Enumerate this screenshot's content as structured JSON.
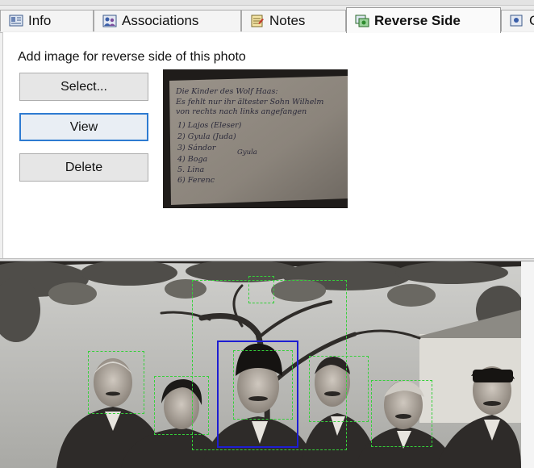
{
  "tabs": [
    {
      "label": "Info",
      "icon": "info-tab-icon",
      "active": false
    },
    {
      "label": "Associations",
      "icon": "associations-tab-icon",
      "active": false
    },
    {
      "label": "Notes",
      "icon": "notes-tab-icon",
      "active": false
    },
    {
      "label": "Reverse Side",
      "icon": "reverse-side-tab-icon",
      "active": true
    },
    {
      "label": "C",
      "icon": "more-tab-icon",
      "active": false
    }
  ],
  "reverse_side": {
    "instruction": "Add image for reverse side of this photo",
    "select_label": "Select...",
    "view_label": "View",
    "delete_label": "Delete",
    "note_lines": [
      "Die Kinder des Wolf Haas:",
      "Es fehlt nur ihr ältester Sohn Wilhelm",
      "von rechts nach links angefangen",
      "1) Lajos (Eleser)",
      "2) Gyula (Juda)",
      "3) Sándor",
      "4) Boga",
      "5. Lina",
      "6) Ferenc"
    ],
    "note_signature": "Gyula"
  },
  "colors": {
    "focus_accent": "#2e7bd1",
    "face_box": "#35d03a",
    "selected_face_box": "#1e1ed2"
  }
}
